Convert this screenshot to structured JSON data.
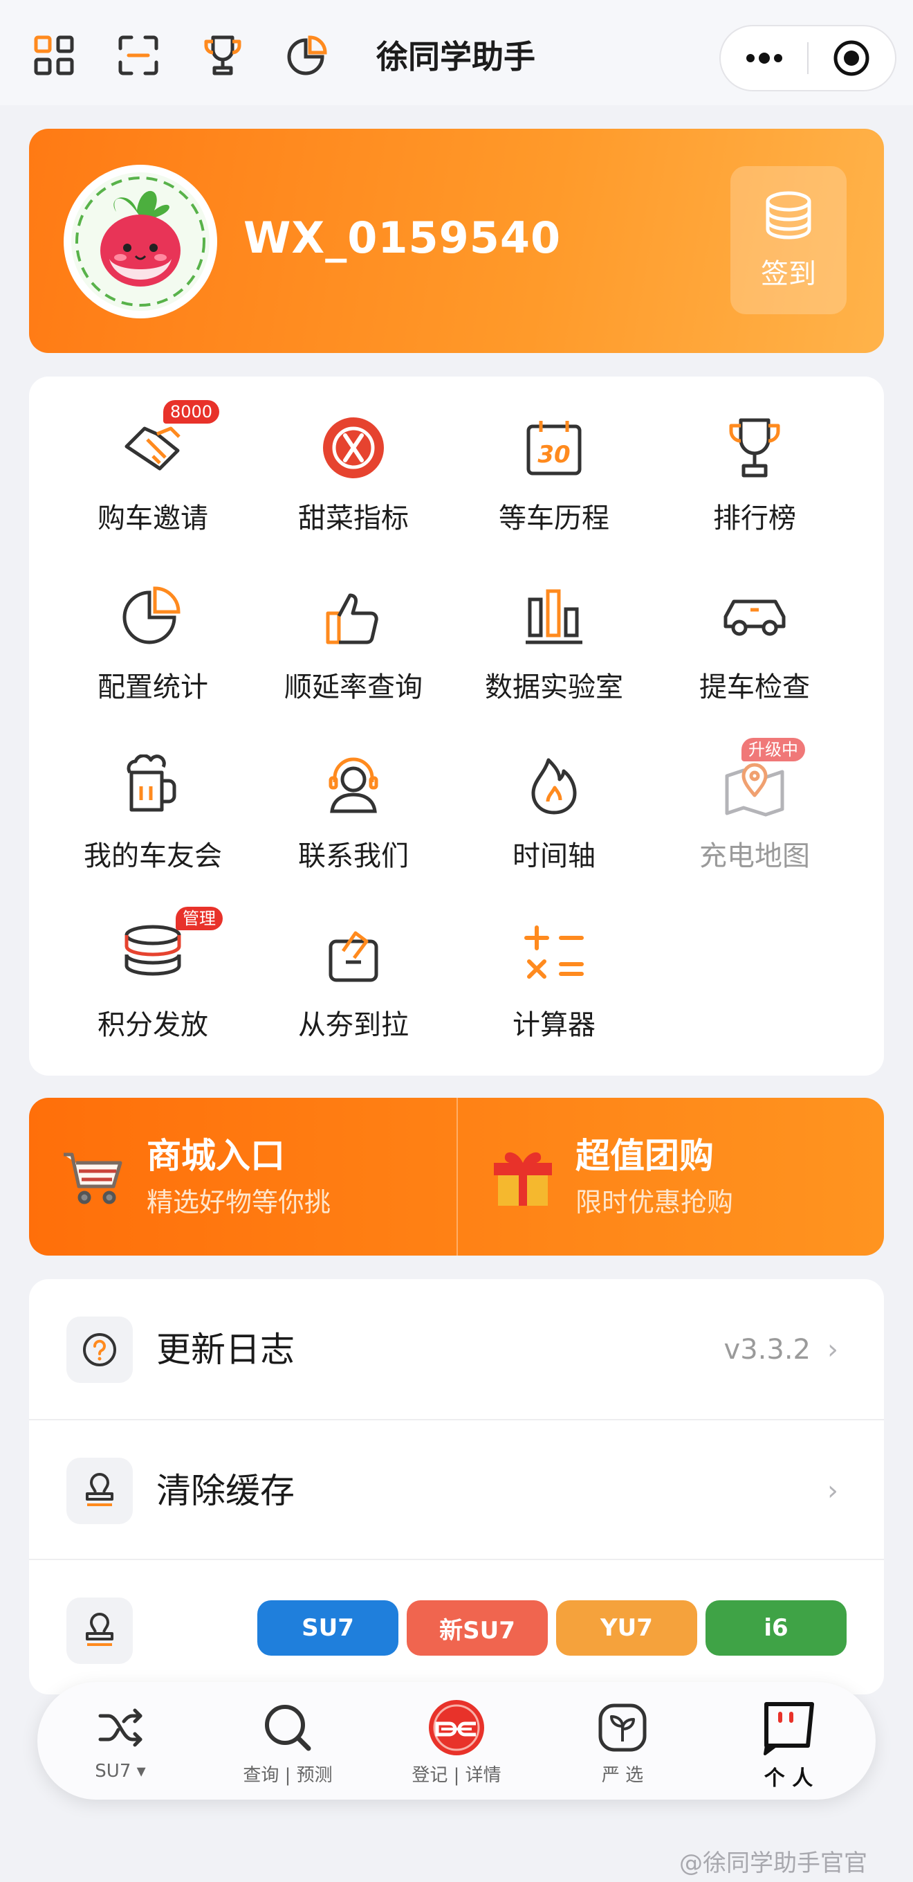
{
  "app": {
    "title": "徐同学助手"
  },
  "profile": {
    "username": "WX_0159540",
    "checkin_label": "签到"
  },
  "grid": {
    "items": [
      {
        "label": "购车邀请",
        "icon": "handshake-icon",
        "badge": "8000"
      },
      {
        "label": "甜菜指标",
        "icon": "x-circle-icon"
      },
      {
        "label": "等车历程",
        "icon": "calendar-30-icon"
      },
      {
        "label": "排行榜",
        "icon": "trophy-icon"
      },
      {
        "label": "配置统计",
        "icon": "pie-chart-icon"
      },
      {
        "label": "顺延率查询",
        "icon": "thumbs-up-icon"
      },
      {
        "label": "数据实验室",
        "icon": "bar-chart-icon"
      },
      {
        "label": "提车检查",
        "icon": "car-icon"
      },
      {
        "label": "我的车友会",
        "icon": "beer-mug-icon"
      },
      {
        "label": "联系我们",
        "icon": "headset-icon"
      },
      {
        "label": "时间轴",
        "icon": "flame-icon"
      },
      {
        "label": "充电地图",
        "icon": "map-pin-icon",
        "badge": "升级中"
      },
      {
        "label": "积分发放",
        "icon": "coin-stack-icon",
        "badge": "管理"
      },
      {
        "label": "从夯到拉",
        "icon": "task-card-icon"
      },
      {
        "label": "计算器",
        "icon": "calculator-icon"
      }
    ]
  },
  "banners": [
    {
      "title": "商城入口",
      "subtitle": "精选好物等你挑",
      "icon": "shopping-cart-icon"
    },
    {
      "title": "超值团购",
      "subtitle": "限时优惠抢购",
      "icon": "gift-box-icon"
    }
  ],
  "list": {
    "changelog": {
      "label": "更新日志",
      "value": "v3.3.2",
      "icon": "question-icon"
    },
    "clear_cache": {
      "label": "清除缓存",
      "icon": "stamp-icon"
    },
    "models": [
      {
        "label": "SU7",
        "color": "#1f7fdc"
      },
      {
        "label": "新SU7",
        "color": "#f0654f"
      },
      {
        "label": "YU7",
        "color": "#f5a23c"
      },
      {
        "label": "i6",
        "color": "#3fa346"
      }
    ]
  },
  "tabs": [
    {
      "label": "SU7 ▾",
      "icon": "shuffle-icon"
    },
    {
      "label": "查询 | 预测",
      "icon": "search-icon"
    },
    {
      "label": "登记 | 详情",
      "icon": "logo-icon"
    },
    {
      "label": "严 选",
      "icon": "sprout-icon"
    },
    {
      "label": "个 人",
      "icon": "profile-face-icon",
      "active": true
    }
  ],
  "watermark": "@徐同学助手官官",
  "colors": {
    "accent": "#ff8a1e",
    "brand_red": "#e8322a"
  }
}
